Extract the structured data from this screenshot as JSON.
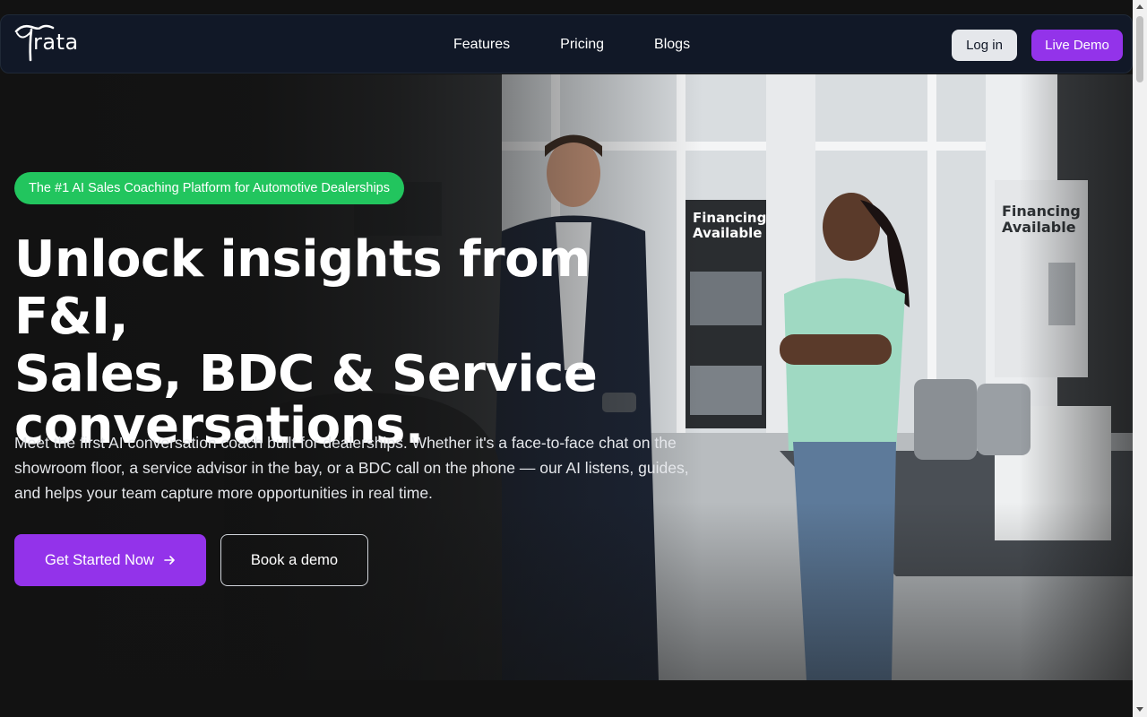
{
  "header": {
    "logo_text": "rata",
    "nav": [
      "Features",
      "Pricing",
      "Blogs"
    ],
    "login_label": "Log in",
    "demo_label": "Live Demo"
  },
  "hero": {
    "badge": "The #1 AI Sales Coaching Platform for Automotive Dealerships",
    "headline_line1": "Unlock insights from F&I,",
    "headline_line2": "Sales, BDC & Service",
    "headline_line3": "conversations.",
    "subtext": "Meet the first AI conversation coach built for dealerships. Whether it's a face-to-face chat on the showroom floor, a service advisor in the bay, or a BDC call on the phone — our AI listens, guides, and helps your team capture more opportunities in real time.",
    "cta_primary": "Get Started Now",
    "cta_primary_icon": "arrow-right-icon",
    "cta_secondary": "Book a demo"
  },
  "photo": {
    "sign_left": "Financing Available",
    "sign_right": "Financing Available"
  },
  "colors": {
    "accent": "#9333ea",
    "badge": "#22c55e",
    "header_bg": "#111827",
    "page_bg": "#121212"
  }
}
